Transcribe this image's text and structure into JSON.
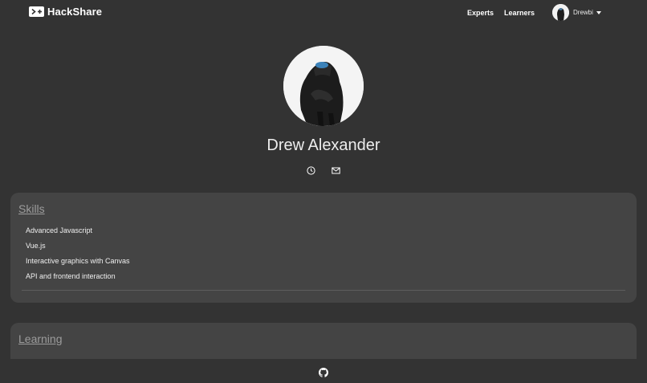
{
  "nav": {
    "brand": "HackShare",
    "links": [
      {
        "label": "Experts"
      },
      {
        "label": "Learners"
      }
    ],
    "user": {
      "name": "Drewbi"
    }
  },
  "profile": {
    "name": "Drew Alexander",
    "contact_icons": [
      "clock-icon",
      "mail-icon"
    ]
  },
  "sections": {
    "skills": {
      "title": "Skills",
      "items": [
        "Advanced Javascript",
        "Vue.js",
        "Interactive graphics with Canvas",
        "API and frontend interaction"
      ]
    },
    "learning": {
      "title": "Learning"
    }
  },
  "footer": {
    "icon": "github-icon"
  },
  "colors": {
    "background": "#333333",
    "card": "#444444",
    "section_title": "#9c9c9c"
  }
}
